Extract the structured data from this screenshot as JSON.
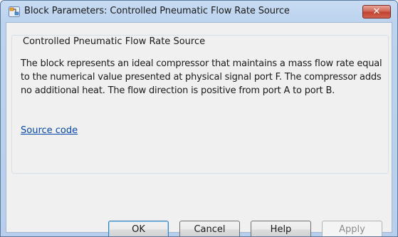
{
  "window": {
    "title": "Block Parameters: Controlled Pneumatic Flow Rate Source",
    "close_glyph": "✕",
    "icon": "simulink-block-icon"
  },
  "group": {
    "title": "Controlled Pneumatic Flow Rate Source",
    "description": "The block represents an ideal compressor that maintains a mass flow rate equal to the numerical value presented at physical signal port F. The compressor adds no additional heat. The flow direction is positive from port A to port B.",
    "link_label": "Source code"
  },
  "buttons": {
    "ok": "OK",
    "cancel": "Cancel",
    "help": "Help",
    "apply": "Apply"
  },
  "colors": {
    "link": "#0645ad",
    "close_button": "#c2412f",
    "title_bar": "#bcd3ee"
  }
}
